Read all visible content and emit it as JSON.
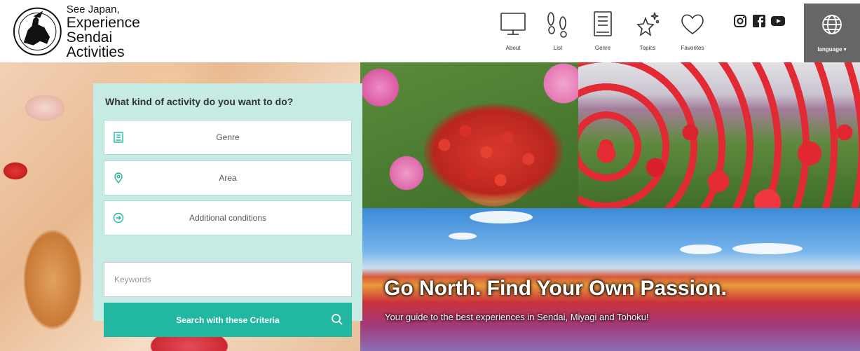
{
  "site": {
    "logo_line1": "See Japan,",
    "logo_line2": "Experience Sendai",
    "logo_line3": "Activities"
  },
  "nav": [
    {
      "label": "About",
      "icon": "monitor-icon"
    },
    {
      "label": "List",
      "icon": "footprints-icon"
    },
    {
      "label": "Genre",
      "icon": "book-icon"
    },
    {
      "label": "Topics",
      "icon": "sparkle-star-icon"
    },
    {
      "label": "Favorites",
      "icon": "heart-icon"
    }
  ],
  "social": [
    "instagram-icon",
    "facebook-icon",
    "youtube-icon"
  ],
  "language": {
    "label": "language ▾",
    "icon": "globe-icon"
  },
  "search": {
    "title": "What kind of activity do you want to do?",
    "genre_label": "Genre",
    "area_label": "Area",
    "additional_label": "Additional conditions",
    "keywords_placeholder": "Keywords",
    "button_label": "Search with these Criteria"
  },
  "hero": {
    "title": "Go North. Find Your Own Passion.",
    "subtitle": "Your guide to the best experiences in Sendai, Miyagi and Tohoku!"
  },
  "colors": {
    "accent": "#22b7a0",
    "panel_bg": "#c6ebe5",
    "language_bg": "#666666"
  }
}
